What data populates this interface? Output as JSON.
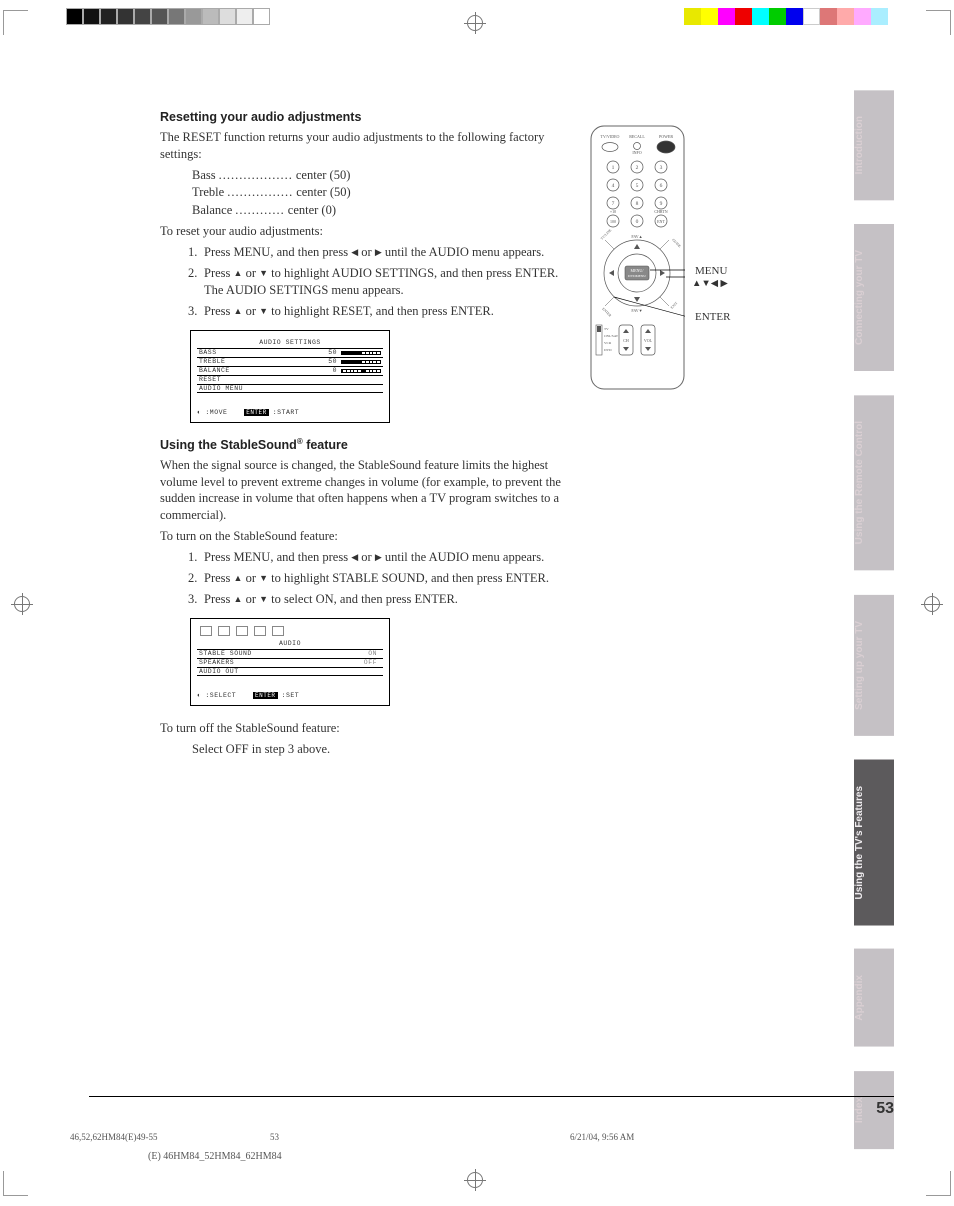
{
  "page_number": "53",
  "sections": {
    "reset": {
      "heading": "Resetting your audio adjustments",
      "intro": "The RESET function returns your audio adjustments to the following factory settings:",
      "settings": [
        {
          "name": "Bass",
          "dots": "..................",
          "value": "center (50)"
        },
        {
          "name": "Treble",
          "dots": "................",
          "value": "center (50)"
        },
        {
          "name": "Balance",
          "dots": "............",
          "value": "center (0)"
        }
      ],
      "action_intro": "To reset your audio adjustments:",
      "steps": [
        {
          "n": "1.",
          "text_a": "Press MENU, and then press ",
          "text_b": " or ",
          "text_c": " until the AUDIO menu appears."
        },
        {
          "n": "2.",
          "text_a": "Press ",
          "text_b": " or ",
          "text_c": " to highlight AUDIO SETTINGS, and then press ENTER. The AUDIO SETTINGS menu appears."
        },
        {
          "n": "3.",
          "text_a": "Press ",
          "text_b": " or ",
          "text_c": " to highlight RESET, and then press ENTER."
        }
      ]
    },
    "osd1": {
      "title": "AUDIO SETTINGS",
      "rows": [
        {
          "label": "BASS",
          "val": "50"
        },
        {
          "label": "TREBLE",
          "val": "50"
        },
        {
          "label": "BALANCE",
          "val": "0"
        },
        {
          "label": "RESET",
          "val": ""
        },
        {
          "label": "AUDIO MENU",
          "val": ""
        }
      ],
      "footer_a": ":MOVE",
      "footer_btn": "ENTER",
      "footer_b": ":START"
    },
    "stable": {
      "heading_a": "Using the StableSound",
      "heading_b": " feature",
      "reg": "®",
      "intro": "When the signal source is changed, the StableSound feature limits the highest volume level to prevent extreme changes in volume (for example, to prevent the sudden increase in volume that often happens when a TV program switches to a commercial).",
      "action_intro": "To turn on the StableSound feature:",
      "steps": [
        {
          "n": "1.",
          "text_a": "Press MENU, and then press ",
          "text_b": " or ",
          "text_c": " until the AUDIO menu appears."
        },
        {
          "n": "2.",
          "text_a": "Press ",
          "text_b": " or ",
          "text_c": " to highlight STABLE SOUND, and then press ENTER."
        },
        {
          "n": "3.",
          "text_a": "Press ",
          "text_b": " or ",
          "text_c": " to select ON, and then press ENTER."
        }
      ],
      "off_intro": "To turn off the StableSound feature:",
      "off_step": "Select OFF in step 3 above."
    },
    "osd2": {
      "title": "AUDIO",
      "rows": [
        {
          "label": "STABLE SOUND",
          "val": "ON"
        },
        {
          "label": "SPEAKERS",
          "val": "OFF"
        },
        {
          "label": "AUDIO OUT",
          "val": ""
        }
      ],
      "footer_a": ":SELECT",
      "footer_btn": "ENTER",
      "footer_b": ":SET"
    }
  },
  "remote": {
    "labels": {
      "tvvideo": "TV/VIDEO",
      "recall": "RECALL",
      "info": "INFO",
      "power": "POWER",
      "plus10": "+10",
      "chrtn": "CHRTN",
      "favup": "FAV▲",
      "favdn": "FAV▼",
      "menu": "MENU/",
      "menu2": "DVDMENU",
      "ch": "CH",
      "vol": "VOL",
      "mode_tv": "TV",
      "mode_cbl": "CBL/SAT",
      "mode_vcr": "VCR",
      "mode_dvd": "DVD",
      "enter": "ENT",
      "hundred": "100"
    },
    "callouts": {
      "menu": "MENU",
      "arrows": "▲▼◀ ▶",
      "enter": "ENTER"
    }
  },
  "tabs": [
    "Introduction",
    "Connecting your TV",
    "Using the Remote Control",
    "Setting up your TV",
    "Using the TV's Features",
    "Appendix",
    "Index"
  ],
  "footer": {
    "file": "46,52,62HM84(E)49-55",
    "page": "53",
    "date": "6/21/04, 9:56 AM",
    "docid": "(E) 46HM84_52HM84_62HM84"
  }
}
